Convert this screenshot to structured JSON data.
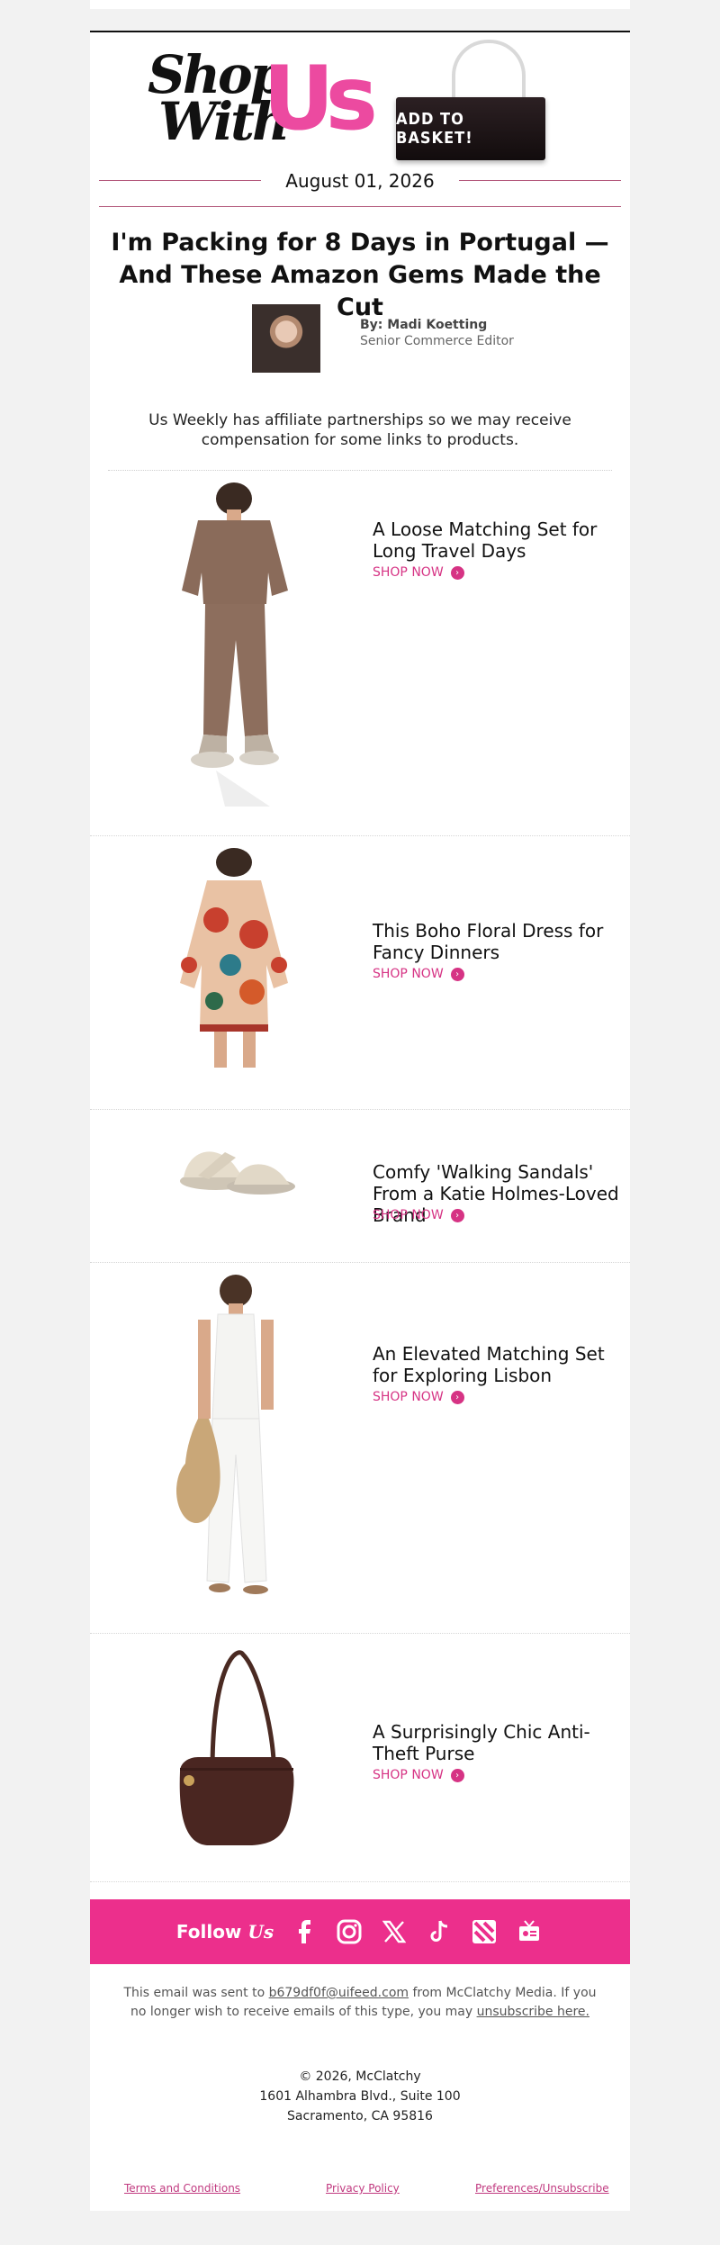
{
  "header": {
    "logo_line1": "Shop",
    "logo_line2": "With",
    "logo_brand": "Us",
    "bag_label": "ADD TO BASKET!",
    "date": "August 01, 2026"
  },
  "article": {
    "headline": "I'm Packing for 8 Days in Portugal — And These Amazon Gems Made the Cut",
    "author_name": "By: Madi Koetting",
    "author_title": "Senior Commerce Editor",
    "disclaimer": "Us Weekly has affiliate partnerships so we may receive compensation for some links to products."
  },
  "products": [
    {
      "title": "A Loose Matching Set for Long Travel Days",
      "cta": "SHOP NOW",
      "image_icon": "brown-lounge-set"
    },
    {
      "title": "This Boho Floral Dress for Fancy Dinners",
      "cta": "SHOP NOW",
      "image_icon": "floral-dress"
    },
    {
      "title": "Comfy 'Walking Sandals' From a Katie Holmes-Loved Brand",
      "cta": "SHOP NOW",
      "image_icon": "walking-sandals"
    },
    {
      "title": "An Elevated Matching Set for Exploring Lisbon",
      "cta": "SHOP NOW",
      "image_icon": "white-linen-set"
    },
    {
      "title": "A Surprisingly Chic Anti-Theft Purse",
      "cta": "SHOP NOW",
      "image_icon": "brown-shoulder-bag"
    }
  ],
  "footer": {
    "follow_prefix": "Follow",
    "follow_brand": "Us",
    "social_icons": [
      "facebook-icon",
      "instagram-icon",
      "x-icon",
      "tiktok-icon",
      "apple-news-icon",
      "podcast-icon"
    ],
    "note_prefix": "This email was sent to",
    "email": "b679df0f@uifeed.com",
    "note_middle": "from McClatchy Media. If you no longer wish to receive emails of this type, you may",
    "unsubscribe_link": "unsubscribe here.",
    "copyright": "© 2026, McClatchy",
    "address_line1": "1601 Alhambra Blvd., Suite 100",
    "address_line2": "Sacramento, CA 95816",
    "terms": "Terms and Conditions",
    "privacy": "Privacy Policy",
    "preferences": "Preferences/Unsubscribe"
  },
  "colors": {
    "brand_pink": "#ec4aa0",
    "cta_pink": "#d63384",
    "follow_bar": "#ec2f8c",
    "rule": "#b25679"
  }
}
